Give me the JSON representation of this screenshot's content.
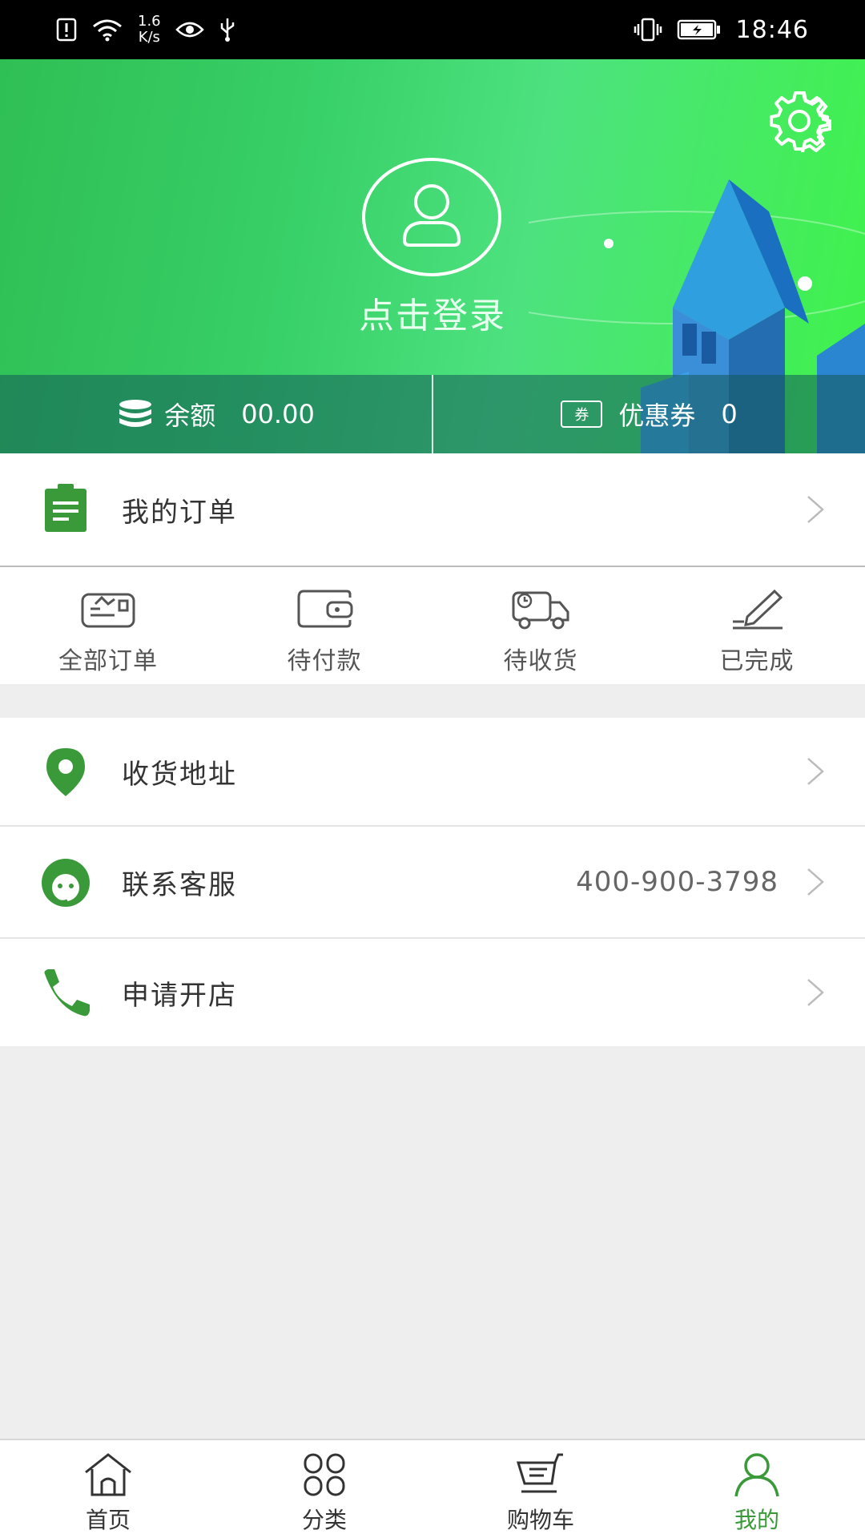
{
  "status_bar": {
    "speed_value": "1.6",
    "speed_unit": "K/s",
    "time": "18:46"
  },
  "header": {
    "login_text": "点击登录",
    "balance_label": "余额",
    "balance_value": "00.00",
    "coupon_badge": "券",
    "coupon_label": "优惠券",
    "coupon_value": "0"
  },
  "orders": {
    "title": "我的订单",
    "tabs": [
      {
        "label": "全部订单",
        "icon": "all-orders-icon"
      },
      {
        "label": "待付款",
        "icon": "wallet-icon"
      },
      {
        "label": "待收货",
        "icon": "delivery-truck-icon"
      },
      {
        "label": "已完成",
        "icon": "pen-icon"
      }
    ]
  },
  "menu": {
    "address": "收货地址",
    "service": "联系客服",
    "service_phone": "400-900-3798",
    "open_shop": "申请开店"
  },
  "bottom_nav": {
    "items": [
      {
        "label": "首页"
      },
      {
        "label": "分类"
      },
      {
        "label": "购物车"
      },
      {
        "label": "我的"
      }
    ]
  },
  "colors": {
    "accent": "#3a9a3a",
    "header_start": "#2fbf54",
    "header_end": "#3ff24a"
  }
}
